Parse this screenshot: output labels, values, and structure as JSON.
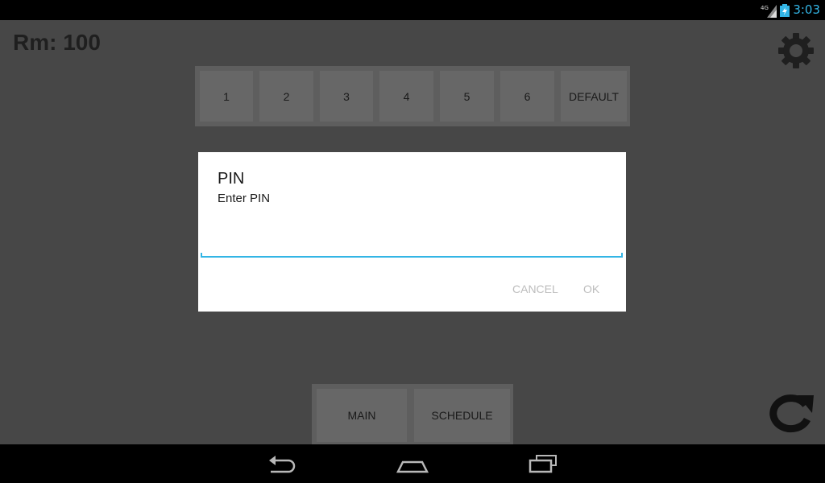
{
  "status_bar": {
    "time": "3:03",
    "network": "4G"
  },
  "header": {
    "room_label": "Rm: 100"
  },
  "room_tabs": [
    {
      "label": "1"
    },
    {
      "label": "2"
    },
    {
      "label": "3"
    },
    {
      "label": "4"
    },
    {
      "label": "5"
    },
    {
      "label": "6"
    },
    {
      "label": "DEFAULT"
    }
  ],
  "bottom_tabs": [
    {
      "label": "MAIN"
    },
    {
      "label": "SCHEDULE"
    }
  ],
  "dialog": {
    "title": "PIN",
    "message": "Enter PIN",
    "input_value": "",
    "cancel_label": "CANCEL",
    "ok_label": "OK"
  },
  "colors": {
    "accent": "#33b5e5",
    "background": "#474747",
    "dialog_bg": "#ffffff",
    "disabled_button": "#bdbdbd"
  },
  "icons": [
    "signal-icon",
    "battery-icon",
    "gear-icon",
    "refresh-icon",
    "back-icon",
    "home-icon",
    "recents-icon"
  ]
}
